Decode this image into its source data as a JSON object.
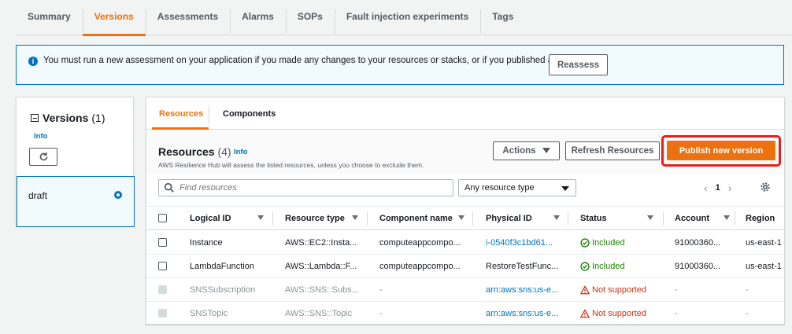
{
  "top_tabs": [
    {
      "label": "Summary"
    },
    {
      "label": "Versions"
    },
    {
      "label": "Assessments"
    },
    {
      "label": "Alarms"
    },
    {
      "label": "SOPs"
    },
    {
      "label": "Fault injection experiments"
    },
    {
      "label": "Tags"
    }
  ],
  "active_tab": "Versions",
  "banner": {
    "text": "You must run a new assessment on your application if you made any changes to your resources or stacks, or if you published a draft.",
    "button": "Reassess"
  },
  "versions": {
    "title": "Versions",
    "count": "(1)",
    "info": "Info",
    "items": [
      {
        "label": "draft",
        "selected": true
      }
    ]
  },
  "inner_tabs": [
    {
      "label": "Resources"
    },
    {
      "label": "Components"
    }
  ],
  "resources": {
    "title": "Resources",
    "count": "(4)",
    "info": "Info",
    "description": "AWS Resilience Hub will assess the listed resources, unless you choose to exclude them.",
    "actions_label": "Actions",
    "refresh_label": "Refresh Resources",
    "publish_label": "Publish new version",
    "search_placeholder": "Find resources",
    "type_filter": "Any resource type",
    "page": "1"
  },
  "table": {
    "columns": [
      "Logical ID",
      "Resource type",
      "Component name",
      "Physical ID",
      "Status",
      "Account",
      "Region"
    ],
    "rows": [
      {
        "logical_id": "Instance",
        "type": "AWS::EC2::Insta...",
        "component": "computeappcompo...",
        "physical_id": "i-0540f3c1bd61...",
        "status": "Included",
        "account": "91000360...",
        "region": "us-east-1"
      },
      {
        "logical_id": "LambdaFunction",
        "type": "AWS::Lambda::F...",
        "component": "computeappcompo...",
        "physical_id": "RestoreTestFunc...",
        "status": "Included",
        "account": "91000360...",
        "region": "us-east-1"
      },
      {
        "logical_id": "SNSSubscription",
        "type": "AWS::SNS::Subs...",
        "component": "-",
        "physical_id": "arn:aws:sns:us-e...",
        "status": "Not supported",
        "account": "-",
        "region": "-"
      },
      {
        "logical_id": "SNSTopic",
        "type": "AWS::SNS::Topic",
        "component": "-",
        "physical_id": "arn:aws:sns:us-e...",
        "status": "Not supported",
        "account": "-",
        "region": "-"
      }
    ]
  },
  "colors": {
    "accent": "#ec7211",
    "link": "#0073bb",
    "success": "#1d8102",
    "error": "#d13212",
    "highlight": "#e41e1e"
  },
  "icons": [
    "info-icon",
    "refresh-icon",
    "search-icon",
    "chevron-left-icon",
    "chevron-right-icon",
    "settings-icon",
    "check-circle-icon",
    "warning-icon"
  ]
}
